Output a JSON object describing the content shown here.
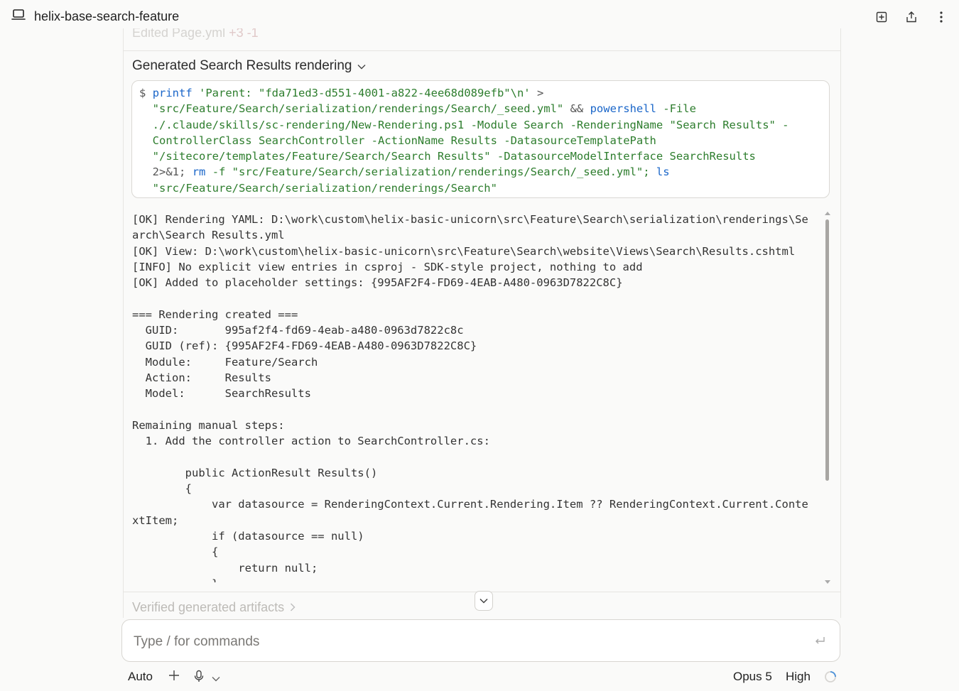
{
  "window": {
    "title": "helix-base-search-feature"
  },
  "previous_section": {
    "label": "Edited Page.yml",
    "counts": "+3 -1"
  },
  "section": {
    "title": "Generated Search Results rendering"
  },
  "command": {
    "prompt": "$",
    "segments": [
      {
        "t": "printf",
        "c": "kw"
      },
      {
        "t": " 'Parent: \"fda71ed3-d551-4001-a822-4ee68d089efb\"\\n' ",
        "c": "str"
      },
      {
        "t": ">",
        "c": "op"
      },
      {
        "t": "\n  \"src/Feature/Search/serialization/renderings/Search/_seed.yml\" ",
        "c": "str"
      },
      {
        "t": "&&",
        "c": "op"
      },
      {
        "t": " ",
        "c": "str"
      },
      {
        "t": "powershell",
        "c": "kw"
      },
      {
        "t": " -File\n  ./.claude/skills/sc-rendering/New-Rendering.ps1 -Module Search -RenderingName \"Search Results\" -\n  ControllerClass SearchController -ActionName Results -DatasourceTemplatePath\n  \"/sitecore/templates/Feature/Search/Search Results\" -DatasourceModelInterface SearchResults\n  ",
        "c": "str"
      },
      {
        "t": "2>&1;",
        "c": "op"
      },
      {
        "t": " ",
        "c": "str"
      },
      {
        "t": "rm",
        "c": "kw"
      },
      {
        "t": " -f \"src/Feature/Search/serialization/renderings/Search/_seed.yml\"; ",
        "c": "str"
      },
      {
        "t": "ls",
        "c": "kw"
      },
      {
        "t": "\n  \"src/Feature/Search/serialization/renderings/Search\"",
        "c": "str"
      }
    ]
  },
  "output": {
    "lines": [
      "[OK] Rendering YAML: D:\\work\\custom\\helix-basic-unicorn\\src\\Feature\\Search\\serialization\\renderings\\Se",
      "arch\\Search Results.yml",
      "[OK] View: D:\\work\\custom\\helix-basic-unicorn\\src\\Feature\\Search\\website\\Views\\Search\\Results.cshtml",
      "[INFO] No explicit view entries in csproj - SDK-style project, nothing to add",
      "[OK] Added to placeholder settings: {995AF2F4-FD69-4EAB-A480-0963D7822C8C}",
      "",
      "=== Rendering created ===",
      "  GUID:       995af2f4-fd69-4eab-a480-0963d7822c8c",
      "  GUID (ref): {995AF2F4-FD69-4EAB-A480-0963D7822C8C}",
      "  Module:     Feature/Search",
      "  Action:     Results",
      "  Model:      SearchResults",
      "",
      "Remaining manual steps:",
      "  1. Add the controller action to SearchController.cs:",
      "",
      "        public ActionResult Results()",
      "        {",
      "            var datasource = RenderingContext.Current.Rendering.Item ?? RenderingContext.Current.Conte",
      "xtItem;",
      "            if (datasource == null)",
      "            {",
      "                return null;",
      "            }"
    ]
  },
  "next_section": {
    "title": "Verified generated artifacts"
  },
  "input": {
    "placeholder": "Type / for commands",
    "value": ""
  },
  "footer": {
    "mode": "Auto",
    "model": "Opus 5",
    "effort": "High"
  },
  "icons": {
    "laptop": "laptop-icon",
    "add_doc": "add-document-icon",
    "share": "share-icon",
    "more": "more-vertical-icon",
    "chevron": "chevron-down-icon",
    "enter": "enter-icon",
    "plus": "plus-icon",
    "mic": "microphone-icon",
    "spinner": "spinner-icon"
  },
  "colors": {
    "keyword": "#1a66c9",
    "string": "#2d7d2d",
    "background": "#fafaf9"
  }
}
